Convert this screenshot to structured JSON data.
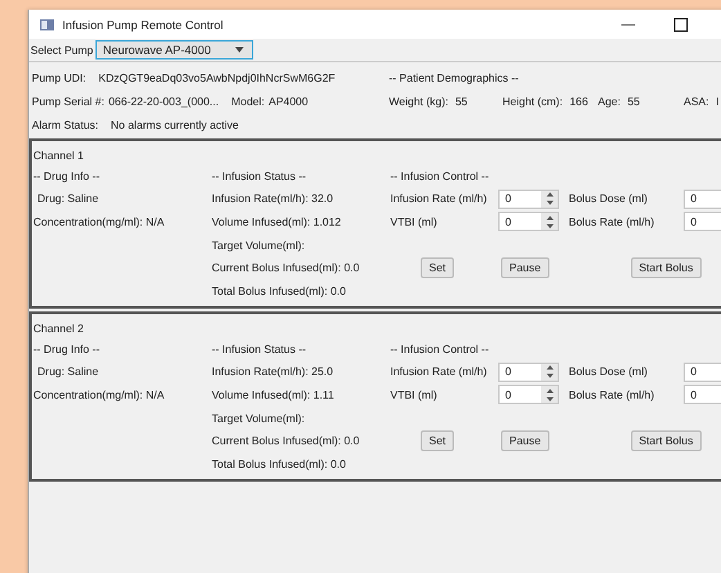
{
  "window": {
    "title": "Infusion Pump Remote Control"
  },
  "pump_select": {
    "label": "Select Pump",
    "value": "Neurowave AP-4000"
  },
  "pump_info": {
    "udi_label": "Pump UDI:",
    "udi": "KDzQGT9eaDq03vo5AwbNpdj0IhNcrSwM6G2F",
    "serial_label": "Pump Serial #:",
    "serial": "066-22-20-003_(000...",
    "model_label": "Model:",
    "model": "AP4000",
    "alarm_label": "Alarm Status:",
    "alarm": "No alarms currently active"
  },
  "patient": {
    "heading": "-- Patient Demographics --",
    "fields": [
      {
        "label": "Weight (kg):",
        "value": "55"
      },
      {
        "label": "Height (cm):",
        "value": "166"
      },
      {
        "label": "Age:",
        "value": "55"
      },
      {
        "label": "ASA:",
        "value": "I"
      }
    ]
  },
  "channels": [
    {
      "title": "Channel 1",
      "drug_heading": "-- Drug Info --",
      "drug": "Drug:  Saline",
      "concentration": "Concentration(mg/ml):  N/A",
      "status_heading": "-- Infusion Status --",
      "status": [
        "Infusion Rate(ml/h):  32.0",
        "Volume Infused(ml):  1.012",
        "Target Volume(ml):",
        "Current Bolus Infused(ml):  0.0",
        "Total Bolus Infused(ml): 0.0"
      ],
      "control_heading": "-- Infusion Control --",
      "inputs": [
        {
          "label": "Infusion Rate (ml/h)",
          "value": "0"
        },
        {
          "label": "Bolus Dose (ml)",
          "value": "0"
        },
        {
          "label": "VTBI (ml)",
          "value": "0"
        },
        {
          "label": "Bolus Rate (ml/h)",
          "value": "0"
        }
      ],
      "buttons": [
        "Set",
        "Pause",
        "Start Bolus"
      ]
    },
    {
      "title": "Channel 2",
      "drug_heading": "-- Drug Info --",
      "drug": "Drug:  Saline",
      "concentration": "Concentration(mg/ml):  N/A",
      "status_heading": "-- Infusion Status --",
      "status": [
        "Infusion Rate(ml/h):  25.0",
        "Volume Infused(ml):  1.11",
        "Target Volume(ml):",
        "Current Bolus Infused(ml):  0.0",
        "Total Bolus Infused(ml): 0.0"
      ],
      "control_heading": "-- Infusion Control --",
      "inputs": [
        {
          "label": "Infusion Rate (ml/h)",
          "value": "0"
        },
        {
          "label": "Bolus Dose (ml)",
          "value": "0"
        },
        {
          "label": "VTBI (ml)",
          "value": "0"
        },
        {
          "label": "Bolus Rate (ml/h)",
          "value": "0"
        }
      ],
      "buttons": [
        "Set",
        "Pause",
        "Start Bolus"
      ]
    }
  ]
}
